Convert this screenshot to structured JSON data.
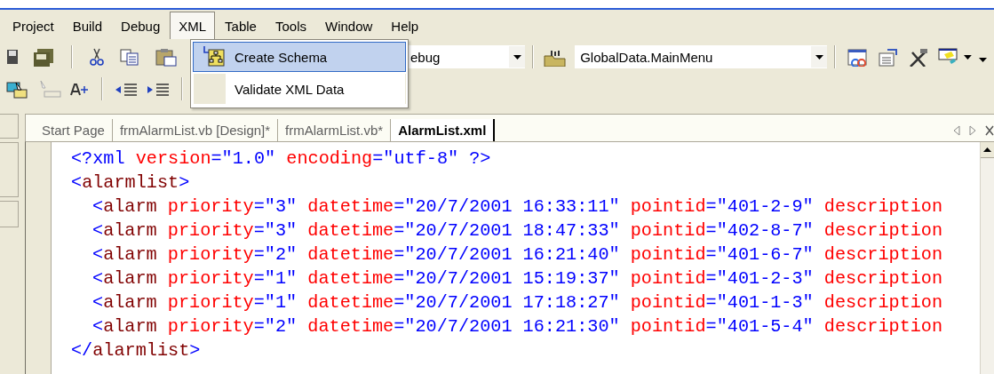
{
  "menu_bar": {
    "items": [
      {
        "label": "Project",
        "selected": false
      },
      {
        "label": "Build",
        "selected": false
      },
      {
        "label": "Debug",
        "selected": false
      },
      {
        "label": "XML",
        "selected": true
      },
      {
        "label": "Table",
        "selected": false
      },
      {
        "label": "Tools",
        "selected": false
      },
      {
        "label": "Window",
        "selected": false
      },
      {
        "label": "Help",
        "selected": false
      }
    ]
  },
  "xml_menu": {
    "items": [
      {
        "label": "Create Schema",
        "selected": true,
        "kind": "icon"
      },
      {
        "label": "Validate XML Data",
        "selected": false,
        "kind": "plain"
      }
    ]
  },
  "toolbar": {
    "configuration_combo": {
      "value": "ebug"
    },
    "startup_combo": {
      "value": "GlobalData.MainMenu"
    }
  },
  "tabs": [
    {
      "label": "Start Page",
      "selected": false
    },
    {
      "label": "frmAlarmList.vb [Design]*",
      "selected": false
    },
    {
      "label": "frmAlarmList.vb*",
      "selected": false
    },
    {
      "label": "AlarmList.xml",
      "selected": true
    }
  ],
  "editor": {
    "lines": [
      {
        "tokens": [
          {
            "kind": "markup",
            "text": "<?xml"
          },
          {
            "kind": "attribute",
            "text": " version"
          },
          {
            "kind": "value",
            "text": "=\"1.0\""
          },
          {
            "kind": "attribute",
            "text": " encoding"
          },
          {
            "kind": "value",
            "text": "=\"utf-8\""
          },
          {
            "kind": "markup",
            "text": " ?>"
          }
        ]
      },
      {
        "tokens": [
          {
            "kind": "markup",
            "text": "<"
          },
          {
            "kind": "element",
            "text": "alarmlist"
          },
          {
            "kind": "markup",
            "text": ">"
          }
        ],
        "children": [
          {
            "tokens": [
              {
                "kind": "markup",
                "text": "<"
              },
              {
                "kind": "element",
                "text": "alarm"
              },
              {
                "kind": "attribute",
                "text": " priority"
              },
              {
                "kind": "value",
                "text": "=\"3\""
              },
              {
                "kind": "attribute",
                "text": " datetime"
              },
              {
                "kind": "value",
                "text": "=\"20/7/2001 16:33:11\""
              },
              {
                "kind": "attribute",
                "text": " pointid"
              },
              {
                "kind": "value",
                "text": "=\"401-2-9\""
              },
              {
                "kind": "attribute",
                "text": " description"
              }
            ]
          },
          {
            "tokens": [
              {
                "kind": "markup",
                "text": "<"
              },
              {
                "kind": "element",
                "text": "alarm"
              },
              {
                "kind": "attribute",
                "text": " priority"
              },
              {
                "kind": "value",
                "text": "=\"3\""
              },
              {
                "kind": "attribute",
                "text": " datetime"
              },
              {
                "kind": "value",
                "text": "=\"20/7/2001 18:47:33\""
              },
              {
                "kind": "attribute",
                "text": " pointid"
              },
              {
                "kind": "value",
                "text": "=\"402-8-7\""
              },
              {
                "kind": "attribute",
                "text": " description"
              }
            ]
          },
          {
            "tokens": [
              {
                "kind": "markup",
                "text": "<"
              },
              {
                "kind": "element",
                "text": "alarm"
              },
              {
                "kind": "attribute",
                "text": " priority"
              },
              {
                "kind": "value",
                "text": "=\"2\""
              },
              {
                "kind": "attribute",
                "text": " datetime"
              },
              {
                "kind": "value",
                "text": "=\"20/7/2001 16:21:40\""
              },
              {
                "kind": "attribute",
                "text": " pointid"
              },
              {
                "kind": "value",
                "text": "=\"401-6-7\""
              },
              {
                "kind": "attribute",
                "text": " description"
              }
            ]
          },
          {
            "tokens": [
              {
                "kind": "markup",
                "text": "<"
              },
              {
                "kind": "element",
                "text": "alarm"
              },
              {
                "kind": "attribute",
                "text": " priority"
              },
              {
                "kind": "value",
                "text": "=\"1\""
              },
              {
                "kind": "attribute",
                "text": " datetime"
              },
              {
                "kind": "value",
                "text": "=\"20/7/2001 15:19:37\""
              },
              {
                "kind": "attribute",
                "text": " pointid"
              },
              {
                "kind": "value",
                "text": "=\"401-2-3\""
              },
              {
                "kind": "attribute",
                "text": " description"
              }
            ]
          },
          {
            "tokens": [
              {
                "kind": "markup",
                "text": "<"
              },
              {
                "kind": "element",
                "text": "alarm"
              },
              {
                "kind": "attribute",
                "text": " priority"
              },
              {
                "kind": "value",
                "text": "=\"1\""
              },
              {
                "kind": "attribute",
                "text": " datetime"
              },
              {
                "kind": "value",
                "text": "=\"20/7/2001 17:18:27\""
              },
              {
                "kind": "attribute",
                "text": " pointid"
              },
              {
                "kind": "value",
                "text": "=\"401-1-3\""
              },
              {
                "kind": "attribute",
                "text": " description"
              }
            ]
          },
          {
            "tokens": [
              {
                "kind": "markup",
                "text": "<"
              },
              {
                "kind": "element",
                "text": "alarm"
              },
              {
                "kind": "attribute",
                "text": " priority"
              },
              {
                "kind": "value",
                "text": "=\"2\""
              },
              {
                "kind": "attribute",
                "text": " datetime"
              },
              {
                "kind": "value",
                "text": "=\"20/7/2001 16:21:30\""
              },
              {
                "kind": "attribute",
                "text": " pointid"
              },
              {
                "kind": "value",
                "text": "=\"401-5-4\""
              },
              {
                "kind": "attribute",
                "text": " description"
              }
            ]
          }
        ]
      },
      {
        "tokens": [
          {
            "kind": "markup",
            "text": "</"
          },
          {
            "kind": "element",
            "text": "alarmlist"
          },
          {
            "kind": "markup",
            "text": ">"
          }
        ]
      }
    ]
  }
}
